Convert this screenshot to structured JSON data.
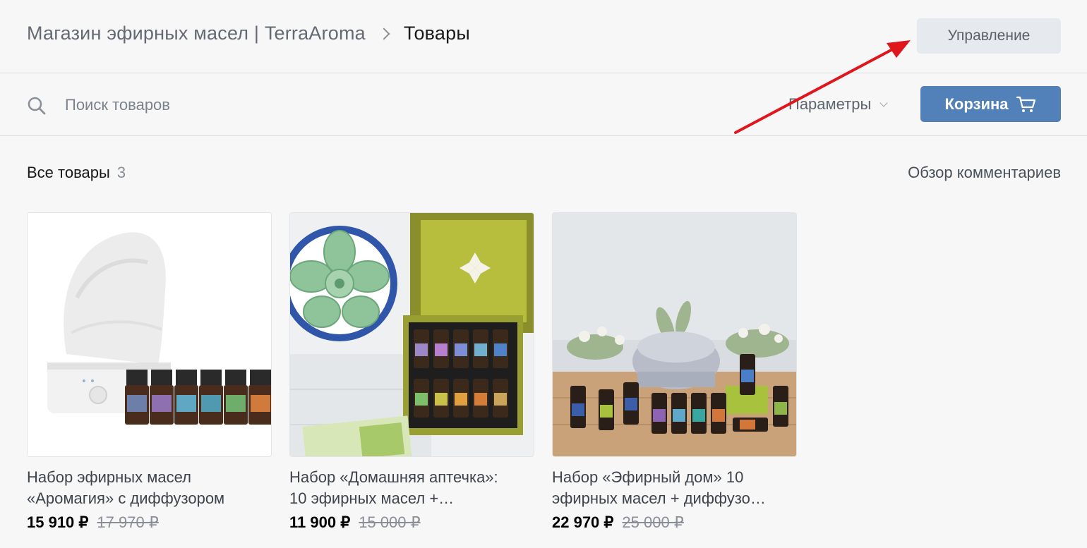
{
  "header": {
    "shop_name": "Магазин эфирных масел | TerraAroma",
    "current_page": "Товары",
    "manage_label": "Управление"
  },
  "toolbar": {
    "search_placeholder": "Поиск товаров",
    "params_label": "Параметры",
    "cart_label": "Корзина"
  },
  "section": {
    "title": "Все товары",
    "count": "3",
    "reviews_link": "Обзор комментариев"
  },
  "products": [
    {
      "title_line1": "Набор эфирных масел",
      "title_line2": "«Аромагия» с диффузором",
      "price": "15 910 ₽",
      "old_price": "17 970 ₽"
    },
    {
      "title_line1": "Набор «Домашняя аптечка»:",
      "title_line2": "10 эфирных масел +…",
      "price": "11 900 ₽",
      "old_price": "15 000 ₽"
    },
    {
      "title_line1": "Набор «Эфирный дом» 10",
      "title_line2": "эфирных масел + диффузо…",
      "price": "22 970 ₽",
      "old_price": "25 000 ₽"
    }
  ],
  "colors": {
    "accent": "#5181b8",
    "annotation_arrow": "#e0161d"
  }
}
